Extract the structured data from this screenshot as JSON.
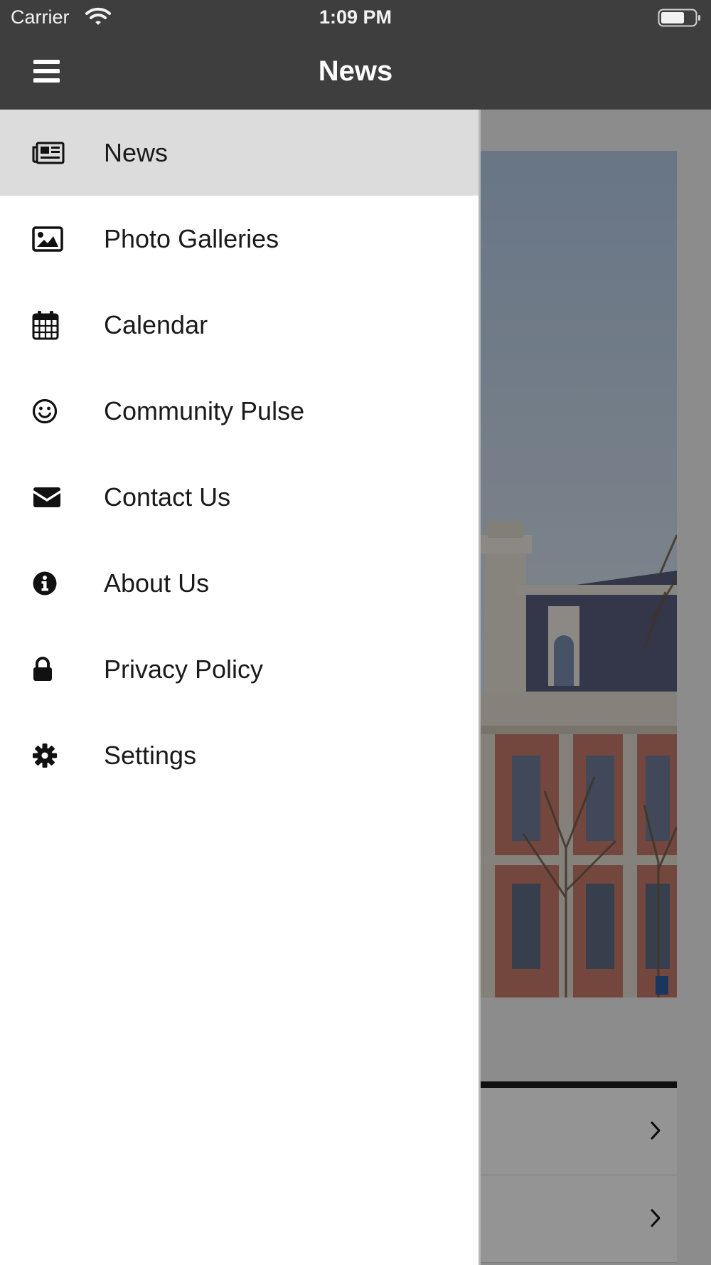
{
  "status_bar": {
    "carrier": "Carrier",
    "time": "1:09 PM",
    "wifi_icon": "wifi-icon",
    "battery_icon": "battery-icon"
  },
  "nav": {
    "title": "News",
    "menu_icon": "hamburger-menu-icon"
  },
  "drawer": {
    "items": [
      {
        "label": "News",
        "icon": "newspaper-icon",
        "active": true
      },
      {
        "label": "Photo Galleries",
        "icon": "image-icon",
        "active": false
      },
      {
        "label": "Calendar",
        "icon": "calendar-icon",
        "active": false
      },
      {
        "label": "Community Pulse",
        "icon": "smiley-icon",
        "active": false
      },
      {
        "label": "Contact Us",
        "icon": "envelope-icon",
        "active": false
      },
      {
        "label": "About Us",
        "icon": "info-icon",
        "active": false
      },
      {
        "label": "Privacy Policy",
        "icon": "lock-icon",
        "active": false
      },
      {
        "label": "Settings",
        "icon": "gear-icon",
        "active": false
      }
    ]
  },
  "colors": {
    "nav_background": "#3f3e3e",
    "active_item_background": "#dcdcdc",
    "drawer_background": "#ffffff"
  }
}
